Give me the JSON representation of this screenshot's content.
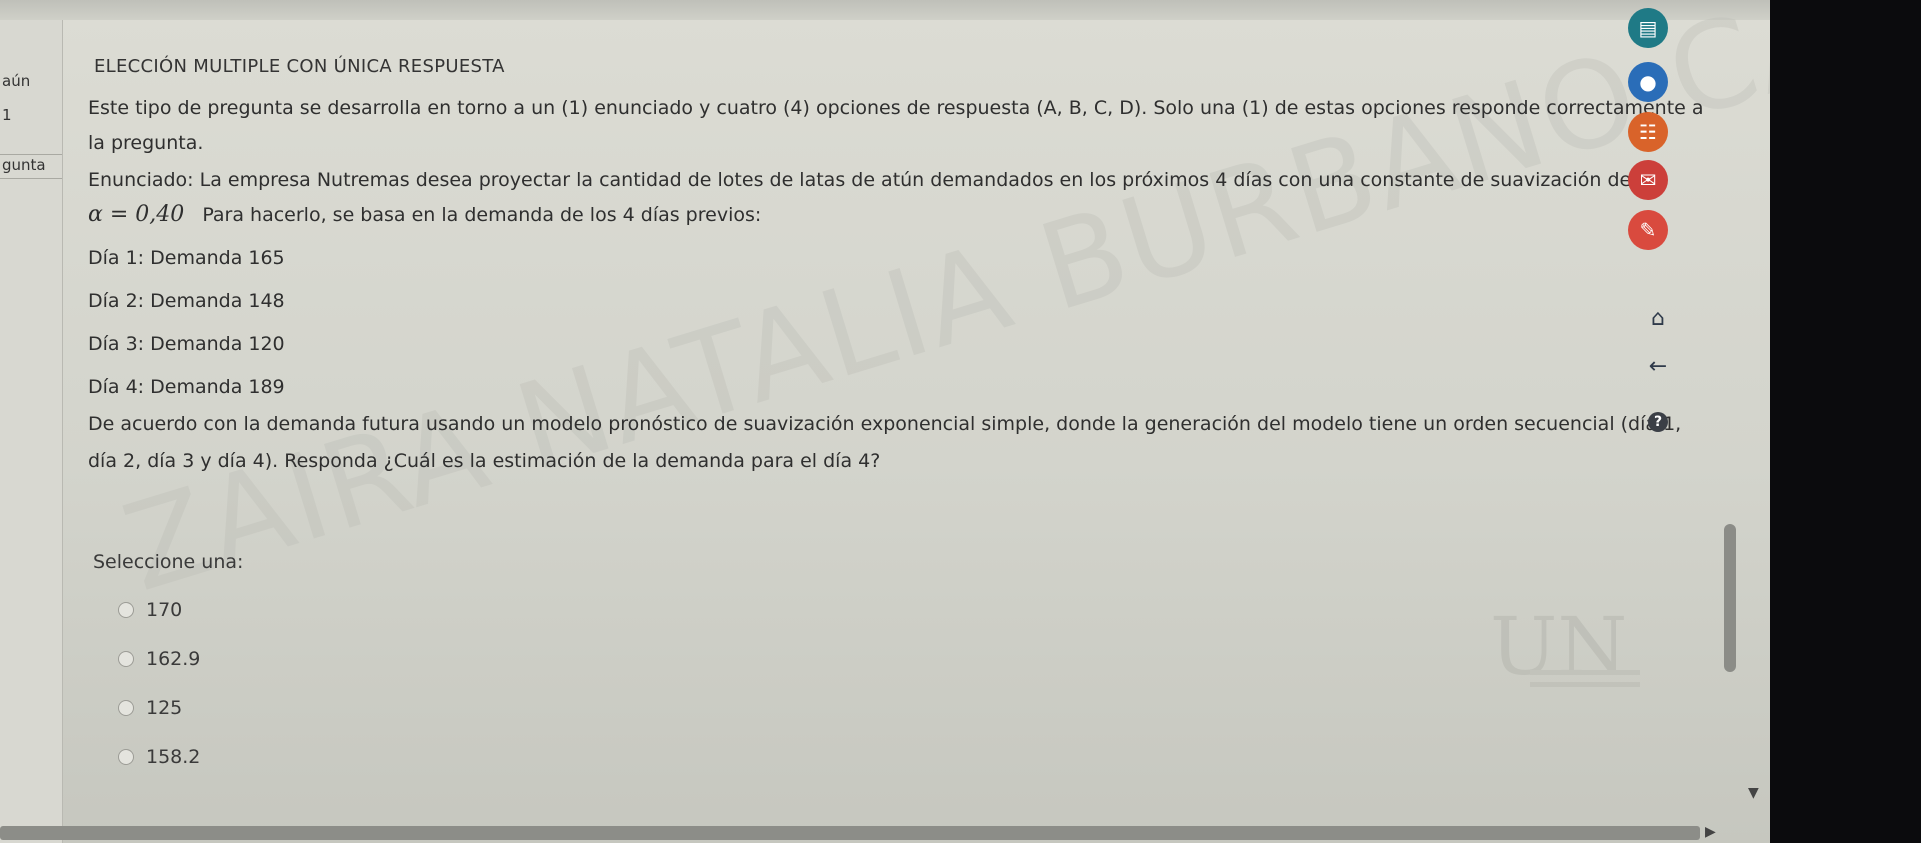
{
  "left_nav": {
    "text1": "aún",
    "text2": "1",
    "text3": "gunta"
  },
  "question": {
    "title": "ELECCIÓN MULTIPLE CON ÚNICA RESPUESTA",
    "intro_line1": "Este tipo de pregunta se desarrolla en torno a un (1) enunciado y cuatro (4) opciones de respuesta (A, B, C, D). Solo una (1) de estas opciones responde correctamente a",
    "intro_line2": "la pregunta.",
    "enunciado_line1": "Enunciado: La empresa Nutremas desea proyectar la cantidad de lotes de latas de atún demandados en los próximos 4 días con una constante de suavización de",
    "alpha_expr": "α = 0,40",
    "enunciado_line2": "Para hacerlo, se basa en la demanda de los 4 días previos:",
    "days": [
      "Día 1: Demanda 165",
      "Día 2: Demanda 148",
      "Día 3: Demanda 120",
      "Día 4: Demanda 189"
    ],
    "question_line1": "De acuerdo con la demanda futura usando un modelo pronóstico de suavización exponencial simple, donde la generación del modelo tiene un orden secuencial (día 1,",
    "question_line2": "día 2, día 3 y día 4). Responda ¿Cuál es la estimación de la demanda para el día 4?",
    "select_prompt": "Seleccione una:",
    "options": [
      "170",
      "162.9",
      "125",
      "158.2"
    ]
  },
  "watermark_text": "ZAIRA NATALIA BURBANO CARDENAS",
  "logo_text": "UN",
  "colors": {
    "icon_teal": "#1f7a86",
    "icon_blue": "#2a6db8",
    "icon_orange": "#d9632a",
    "icon_red": "#cc3f3a",
    "icon_coral": "#d94a3e"
  }
}
